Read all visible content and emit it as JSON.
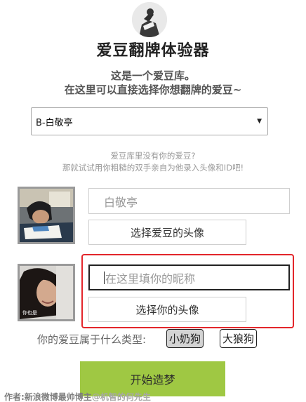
{
  "app": {
    "title": "爱豆翻牌体验器"
  },
  "intro": {
    "line1": "这是一个爱豆库。",
    "line2": "在这里可以直接选择你想翻牌的爱豆~"
  },
  "idol_select": {
    "selected": "B-白敬亭",
    "arrow": "▼"
  },
  "hint": {
    "line1": "爱豆库里没有你的爱豆?",
    "line2": "那就试试用你粗糙的双手亲自为他录入头像和ID吧!"
  },
  "idol_form": {
    "name_value": "白敬亭",
    "choose_avatar_label": "选择爱豆的头像"
  },
  "user_form": {
    "nickname_placeholder": "在这里填你的昵称",
    "choose_avatar_label": "选择你的头像",
    "avatar_caption": "你也是"
  },
  "type_question": {
    "label": "你的爱豆属于什么类型:",
    "options": [
      {
        "label": "小奶狗",
        "selected": true
      },
      {
        "label": "大狼狗",
        "selected": false
      }
    ]
  },
  "start_button": {
    "label": "开始造梦"
  },
  "watermark": {
    "author": "作者:新浪微博最帅博主",
    "handle": "@机智的何先生"
  },
  "colors": {
    "accent": "#9fc843",
    "highlight": "#e3262b"
  }
}
